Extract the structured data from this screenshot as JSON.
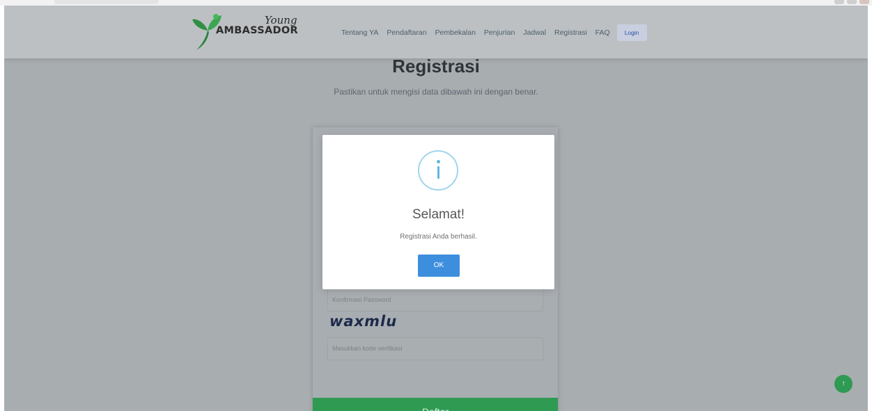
{
  "navbar": {
    "logo_script": "Young",
    "logo_word": "AMBASSADOR",
    "links": [
      "Tentang YA",
      "Pendaftaran",
      "Pembekalan",
      "Penjurian",
      "Jadwal",
      "Registrasi",
      "FAQ"
    ],
    "login_label": "Login"
  },
  "page": {
    "title": "Registrasi",
    "subtitle": "Pastikan untuk mengisi data dibawah ini dengan benar."
  },
  "form": {
    "confirm_password_placeholder": "Konfirmasi Password",
    "captcha_text": "waxmlu",
    "verification_placeholder": "Masukkan kode verifikasi",
    "submit_label": "Daftar"
  },
  "modal": {
    "title": "Selamat!",
    "message": "Registrasi Anda berhasil.",
    "ok_label": "OK"
  },
  "scroll_top_icon": "arrow-up-icon",
  "colors": {
    "overlay_page": "#a8adb0",
    "brand_green": "#2e9a52",
    "ok_blue": "#3d8fdd",
    "info_icon": "#62b7dc"
  }
}
